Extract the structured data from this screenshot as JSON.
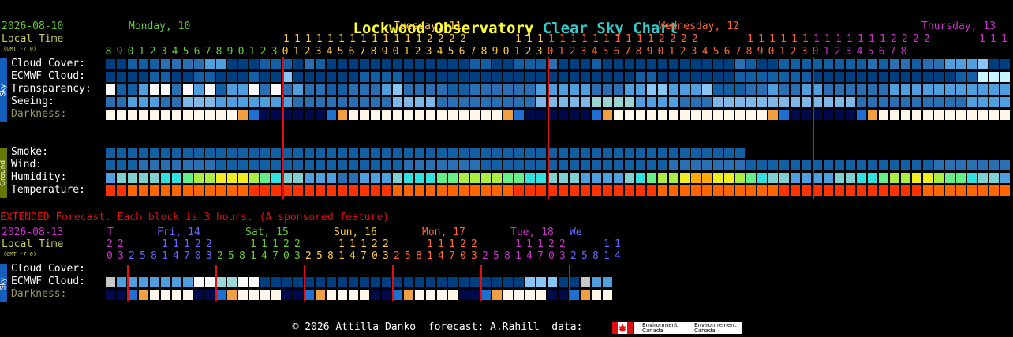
{
  "title": {
    "part1": "Lockwood Observatory",
    "part2": "Clear Sky Chart"
  },
  "header": {
    "date": "2026-08-10",
    "local_time_label": "Local Time",
    "gmt_label": "(GMT -7.0)",
    "days": [
      {
        "label": "Monday, 10",
        "color": "#66cc33"
      },
      {
        "label": "Tuesday, 11",
        "color": "#ffcc33"
      },
      {
        "label": "Wednesday, 12",
        "color": "#ff6633"
      },
      {
        "label": "Thursday, 13",
        "color": "#cc33cc"
      }
    ],
    "hours_tens": "11111111111112222    11111111111112222    11111111111112222    11111111",
    "hours_ones": "8901234567890123012345678901234567890123012345678901234567890123012345678"
  },
  "sky_rows": [
    {
      "label": "Cloud Cover:",
      "color": "#ffffff"
    },
    {
      "label": "ECMWF Cloud:",
      "color": "#ffffff"
    },
    {
      "label": "Transparency:",
      "color": "#ffffff"
    },
    {
      "label": "Seeing:",
      "color": "#ffffff"
    },
    {
      "label": "Darkness:",
      "color": "#999966"
    }
  ],
  "ground_rows": [
    {
      "label": "Smoke:"
    },
    {
      "label": "Wind:"
    },
    {
      "label": "Humidity:"
    },
    {
      "label": "Temperature:"
    }
  ],
  "side_labels": {
    "sky": "Sky",
    "ground": "Ground",
    "sky2": "Sky"
  },
  "extended": {
    "notice": "EXTENDED Forecast. Each block is 3 hours. (A sponsored feature)",
    "date": "2026-08-13",
    "local_time_label": "Local Time",
    "gmt_label": "(GMT -7.0)",
    "days": [
      {
        "label": "T",
        "color": "#cc33cc"
      },
      {
        "label": "Fri, 14",
        "color": "#6666ff"
      },
      {
        "label": "Sat, 15",
        "color": "#66cc33"
      },
      {
        "label": "Sun, 16",
        "color": "#ffcc33"
      },
      {
        "label": "Mon, 17",
        "color": "#ff6633"
      },
      {
        "label": "Tue, 18",
        "color": "#cc33cc"
      },
      {
        "label": "We",
        "color": "#6666ff"
      }
    ],
    "hours_tens": "22   11122   11122   11122   11122   11122   11",
    "hours_ones": "03258147032581470325814703258147032581470325814",
    "rows": [
      {
        "label": "Cloud Cover:",
        "color": "#ffffff"
      },
      {
        "label": "ECMWF Cloud:",
        "color": "#ffffff"
      },
      {
        "label": "Darkness:",
        "color": "#999966"
      }
    ]
  },
  "footer": {
    "text": "© 2026 Attilla Danko  forecast: A.Rahill  data:",
    "env1": "Environment Canada",
    "env2": "Environnement Canada"
  },
  "colors": {
    "deep_blue": "#003f7f",
    "mid_blue": "#135fa3",
    "blue": "#2b6fb3",
    "light_blue": "#4f9fdf",
    "pale_blue": "#87c6f5",
    "cyan_white": "#c6f5ff",
    "white": "#fafafa",
    "gray": "#c8c8c8",
    "red_line": "#e01010",
    "temp_red": "#ff3300",
    "temp_orange": "#ff6600"
  }
}
